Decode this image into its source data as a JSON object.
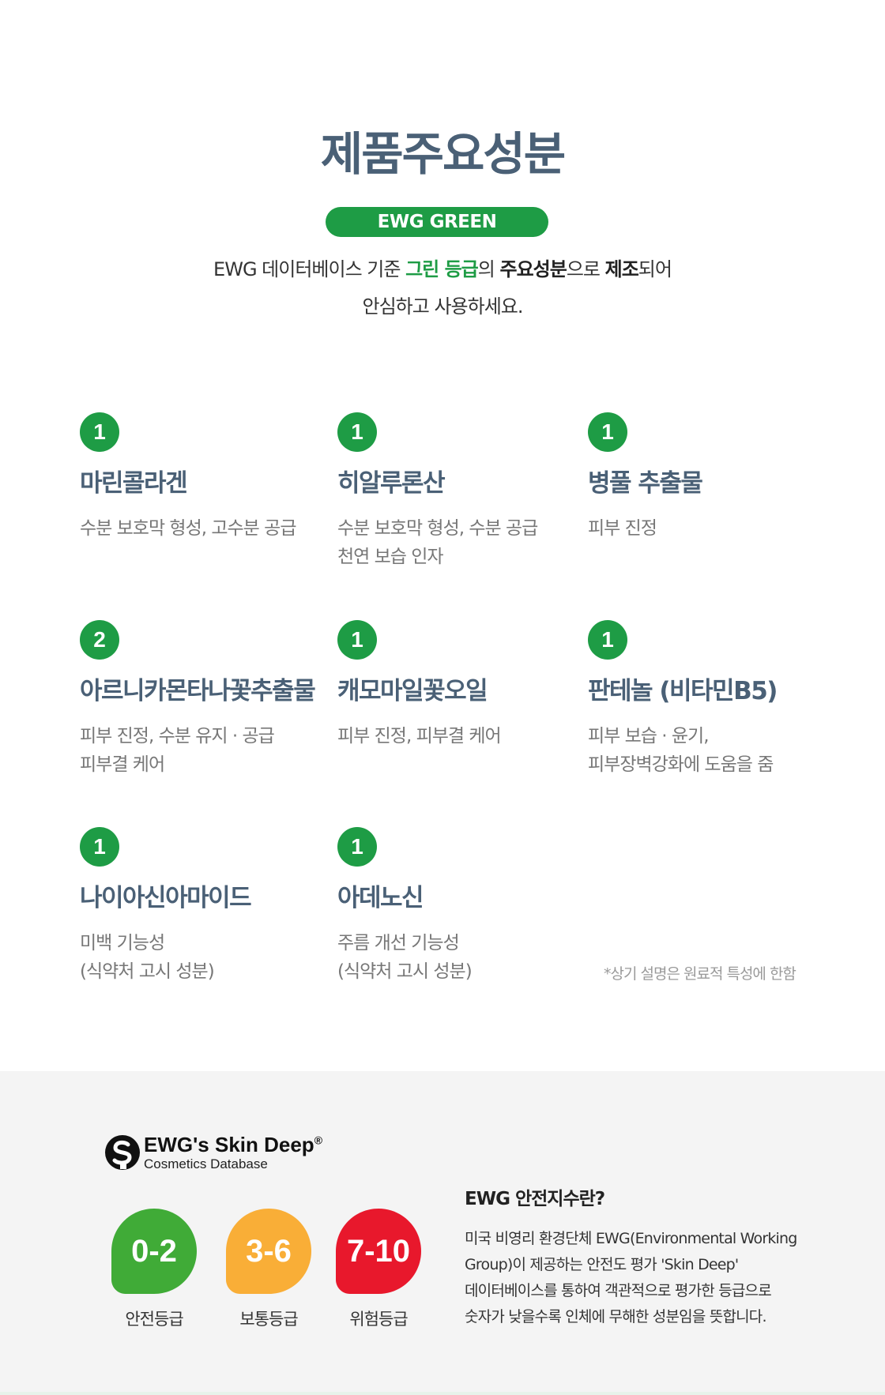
{
  "header": {
    "title": "제품주요성분",
    "pill": "EWG GREEN",
    "intro": {
      "line1_part1": "EWG 데이터베이스 기준 ",
      "line1_green": "그린 등급",
      "line1_part2": "의 ",
      "line1_bold1": "주요성분",
      "line1_part3": "으로 ",
      "line1_bold2": "제조",
      "line1_part4": "되어",
      "line2": "안심하고 사용하세요."
    }
  },
  "ingredients": [
    {
      "grade": "1",
      "name": "마린콜라겐",
      "desc": [
        "수분 보호막 형성, 고수분 공급"
      ]
    },
    {
      "grade": "1",
      "name": "히알루론산",
      "desc": [
        "수분 보호막 형성, 수분 공급",
        "천연 보습 인자"
      ]
    },
    {
      "grade": "1",
      "name": "병풀 추출물",
      "desc": [
        "피부 진정"
      ]
    },
    {
      "grade": "2",
      "name": "아르니카몬타나꽃추출물",
      "desc": [
        "피부 진정, 수분 유지 · 공급",
        "피부결 케어"
      ]
    },
    {
      "grade": "1",
      "name": "캐모마일꽃오일",
      "desc": [
        "피부 진정, 피부결 케어"
      ]
    },
    {
      "grade": "1",
      "name": "판테놀 (비타민B5)",
      "desc": [
        "피부 보습 · 윤기,",
        "피부장벽강화에 도움을 줌"
      ]
    },
    {
      "grade": "1",
      "name": "나이아신아마이드",
      "desc": [
        "미백 기능성",
        "(식약처 고시 성분)"
      ]
    },
    {
      "grade": "1",
      "name": "아데노신",
      "desc": [
        "주름 개선 기능성",
        "(식약처 고시 성분)"
      ]
    }
  ],
  "footnote": "*상기 설명은 원료적 특성에 한함",
  "skin_deep": {
    "logo_title": "EWG's Skin Deep",
    "logo_reg": "®",
    "logo_sub": "Cosmetics Database",
    "grades": [
      {
        "range": "0-2",
        "label": "안전등급",
        "color": "#40ab37"
      },
      {
        "range": "3-6",
        "label": "보통등급",
        "color": "#f9ae37"
      },
      {
        "range": "7-10",
        "label": "위험등급",
        "color": "#e8182c"
      }
    ],
    "safety_title": "EWG 안전지수란?",
    "safety_body": [
      "미국 비영리 환경단체  EWG(Environmental Working",
      "Group)이 제공하는 안전도 평가 'Skin Deep'",
      "데이터베이스를 통하여 객관적으로 평가한 등급으로",
      "숫자가 낮을수록 인체에 무해한 성분임을 뜻합니다."
    ]
  }
}
